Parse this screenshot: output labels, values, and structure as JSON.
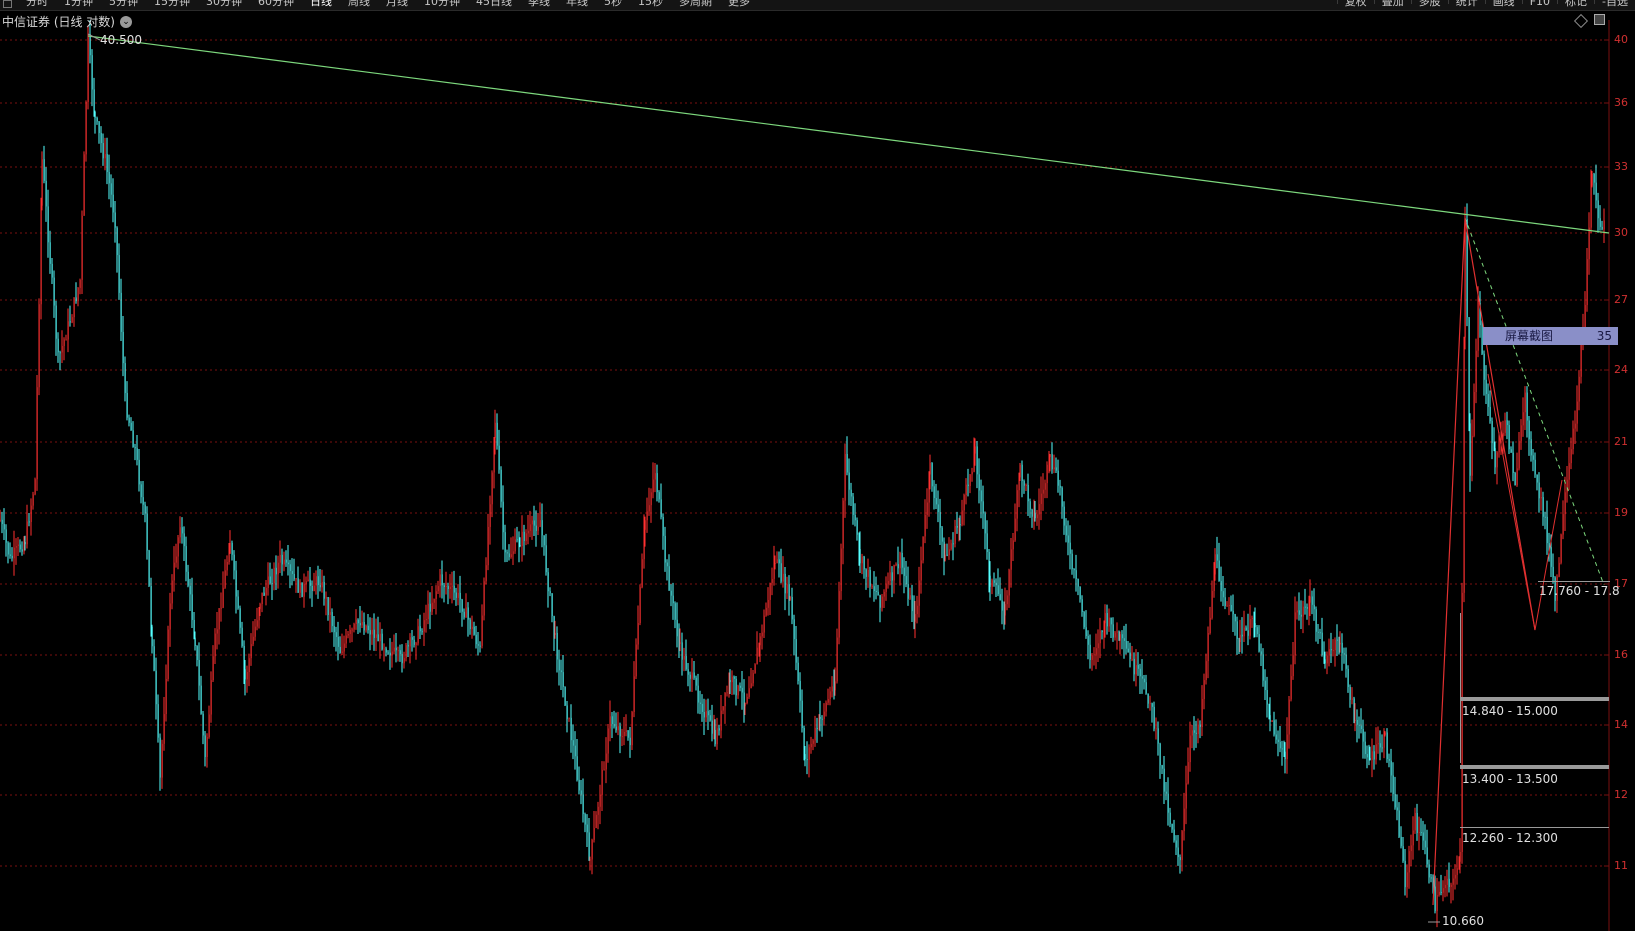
{
  "toolbar": {
    "periods": [
      {
        "label": "分时",
        "active": false
      },
      {
        "label": "1分钟",
        "active": false
      },
      {
        "label": "5分钟",
        "active": false
      },
      {
        "label": "15分钟",
        "active": false
      },
      {
        "label": "30分钟",
        "active": false
      },
      {
        "label": "60分钟",
        "active": false
      },
      {
        "label": "日线",
        "active": true
      },
      {
        "label": "周线",
        "active": false
      },
      {
        "label": "月线",
        "active": false
      },
      {
        "label": "10分钟",
        "active": false
      },
      {
        "label": "45日线",
        "active": false
      },
      {
        "label": "季线",
        "active": false
      },
      {
        "label": "年线",
        "active": false
      },
      {
        "label": "5秒",
        "active": false
      },
      {
        "label": "15秒",
        "active": false
      },
      {
        "label": "多周期",
        "active": false
      },
      {
        "label": "更多",
        "active": false
      }
    ],
    "right_buttons": [
      "复权",
      "叠加",
      "多股",
      "统计",
      "画线",
      "F10",
      "标记",
      "-自选"
    ]
  },
  "title": "中信证券 (日线 对数)",
  "title_menu_icon": "chevron-down-icon",
  "price_axis_labels": [
    "40",
    "36",
    "33",
    "30",
    "27",
    "24",
    "21",
    "19",
    "17",
    "16",
    "14",
    "12",
    "11"
  ],
  "annotations": {
    "high_label": "40.500",
    "low_label": "10.660",
    "screenshot_label": "屏幕截图",
    "screenshot_value": "35",
    "ranges": [
      {
        "text": "17.760 - 17.8"
      },
      {
        "text": "14.840 - 15.000"
      },
      {
        "text": "13.400 - 13.500"
      },
      {
        "text": "12.260 - 12.300"
      }
    ]
  },
  "colors": {
    "up": "#ff3030",
    "down": "#54ffff",
    "trendline": "#7dd87d",
    "grid": "#7a0f0f",
    "axis_text": "#d03030"
  }
}
